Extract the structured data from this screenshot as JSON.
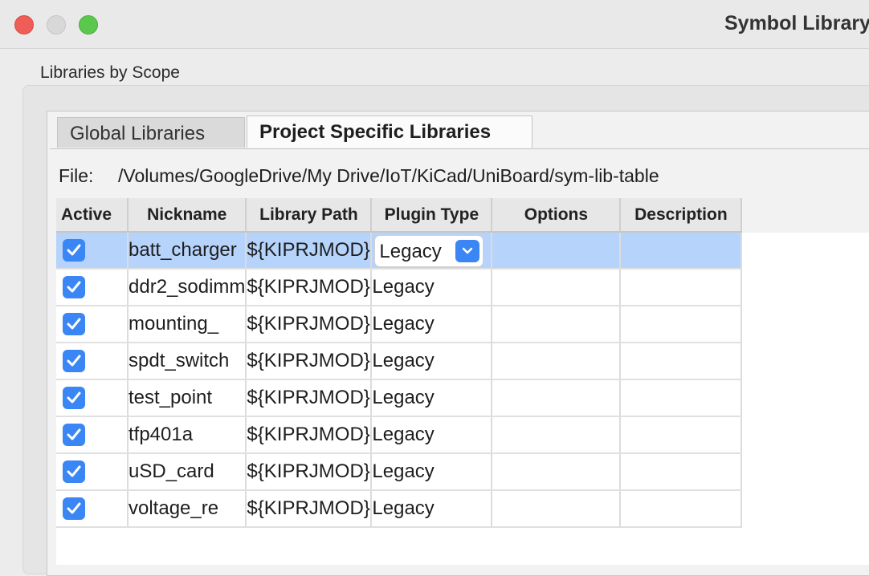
{
  "window": {
    "title": "Symbol Library"
  },
  "scope_label": "Libraries by Scope",
  "tabs": [
    {
      "label": "Global Libraries",
      "selected": false
    },
    {
      "label": "Project Specific Libraries",
      "selected": true
    }
  ],
  "file": {
    "label": "File:",
    "path": "/Volumes/GoogleDrive/My Drive/IoT/KiCad/UniBoard/sym-lib-table"
  },
  "table": {
    "columns": [
      "Active",
      "Nickname",
      "Library Path",
      "Plugin Type",
      "Options",
      "Description"
    ],
    "rows": [
      {
        "active": true,
        "nickname": "batt_charger",
        "path": "${KIPRJMOD}",
        "plugin": "Legacy",
        "options": "",
        "description": ""
      },
      {
        "active": true,
        "nickname": "ddr2_sodimm",
        "path": "${KIPRJMOD}",
        "plugin": "Legacy",
        "options": "",
        "description": ""
      },
      {
        "active": true,
        "nickname": "mounting_",
        "path": "${KIPRJMOD}",
        "plugin": "Legacy",
        "options": "",
        "description": ""
      },
      {
        "active": true,
        "nickname": "spdt_switch",
        "path": "${KIPRJMOD}",
        "plugin": "Legacy",
        "options": "",
        "description": ""
      },
      {
        "active": true,
        "nickname": "test_point",
        "path": "${KIPRJMOD}",
        "plugin": "Legacy",
        "options": "",
        "description": ""
      },
      {
        "active": true,
        "nickname": "tfp401a",
        "path": "${KIPRJMOD}",
        "plugin": "Legacy",
        "options": "",
        "description": ""
      },
      {
        "active": true,
        "nickname": "uSD_card",
        "path": "${KIPRJMOD}",
        "plugin": "Legacy",
        "options": "",
        "description": ""
      },
      {
        "active": true,
        "nickname": "voltage_re",
        "path": "${KIPRJMOD}",
        "plugin": "Legacy",
        "options": "",
        "description": ""
      }
    ],
    "selected_row": 0
  },
  "colors": {
    "accent": "#3a86f5",
    "selection": "#b5d3fb"
  }
}
